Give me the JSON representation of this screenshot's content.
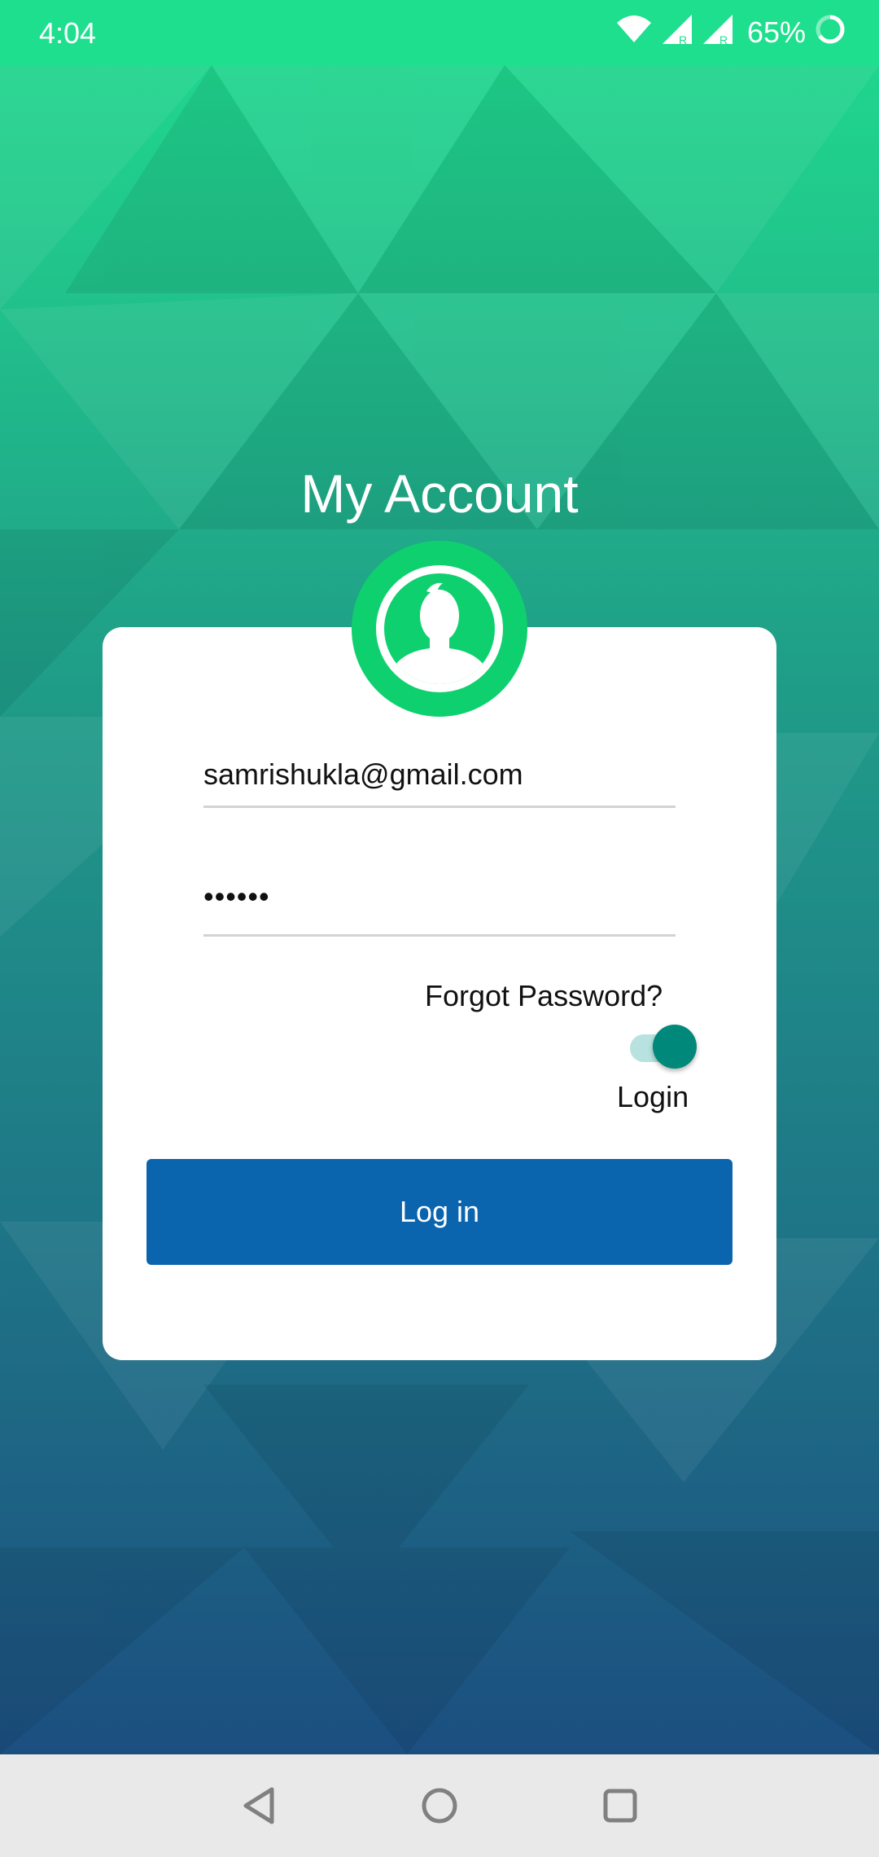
{
  "status_bar": {
    "time": "4:04",
    "battery_text": "65%",
    "icons": [
      "wifi-icon",
      "signal-icon",
      "signal-icon",
      "battery-ring-icon"
    ]
  },
  "title": "My Account",
  "avatar": {
    "icon": "user-silhouette-icon"
  },
  "form": {
    "email_value": "samrishukla@gmail.com",
    "password_value": "••••••",
    "forgot_password_label": "Forgot Password?",
    "toggle_label": "Login",
    "toggle_on": true,
    "login_button_label": "Log in"
  },
  "nav": {
    "back_icon": "back-triangle-icon",
    "home_icon": "home-circle-icon",
    "recents_icon": "recents-square-icon"
  },
  "colors": {
    "status_bar": "#1edf8e",
    "avatar": "#0fd06f",
    "button": "#0b64ae",
    "toggle_thumb": "#00897b",
    "toggle_track": "#b7e2e0"
  }
}
